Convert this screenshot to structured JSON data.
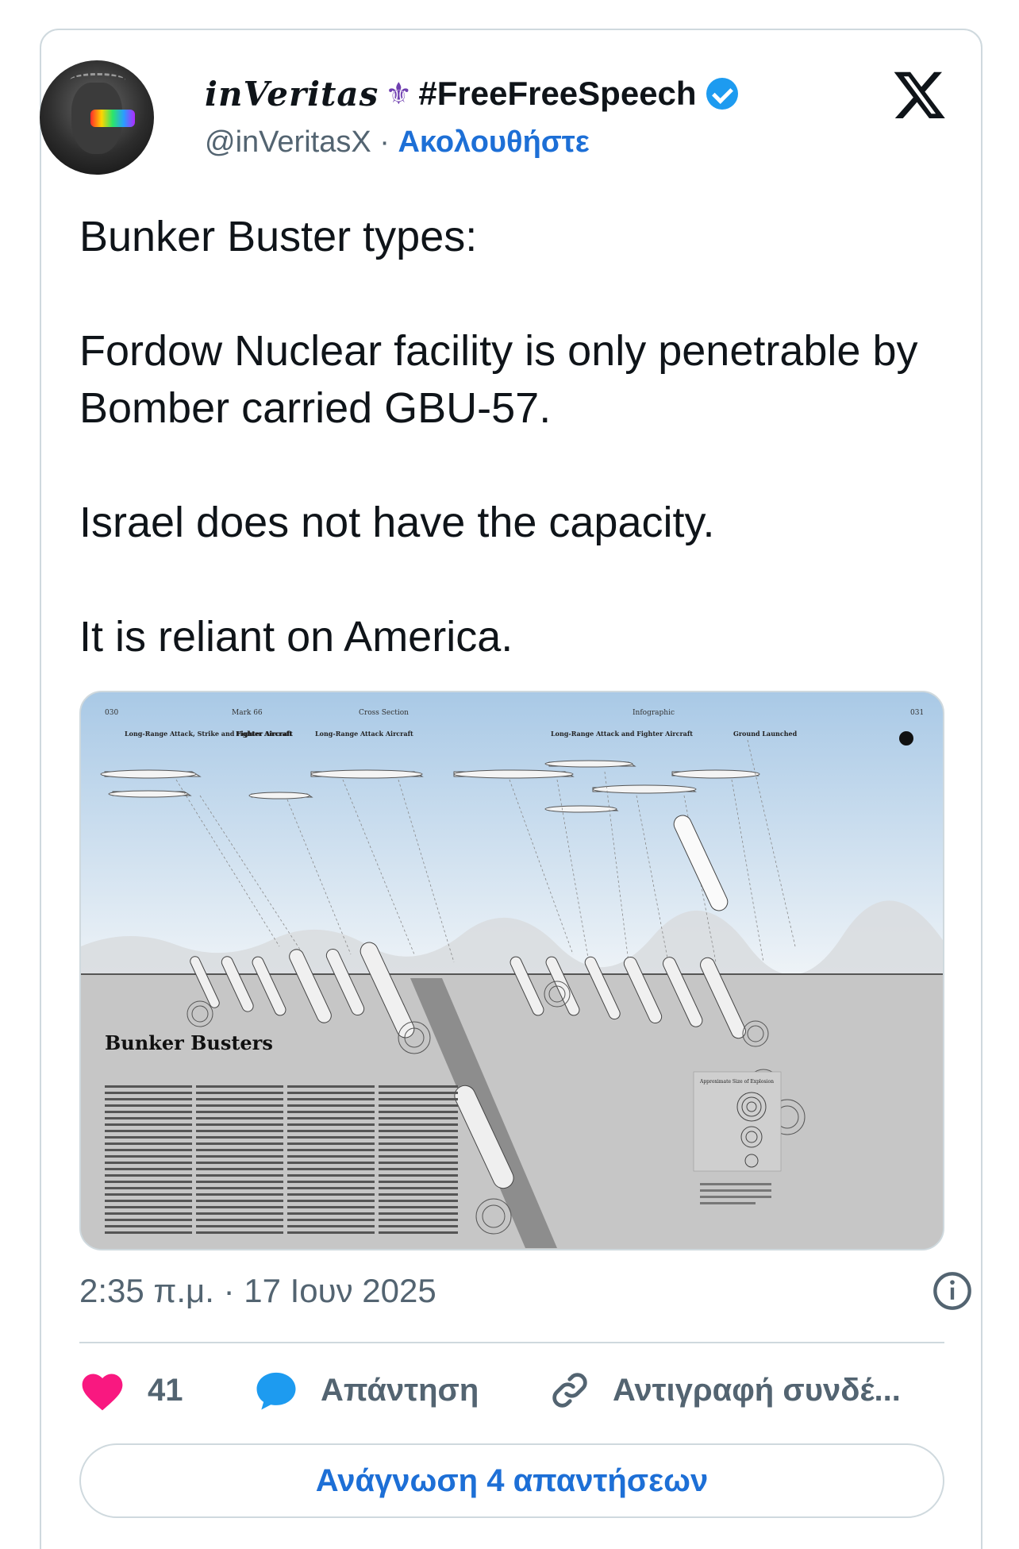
{
  "author": {
    "display_name": "inVeritas",
    "hashtag": "#FreeFreeSpeech",
    "handle": "@inVeritasX",
    "separator": "·",
    "follow_label": "Ακολουθήστε"
  },
  "tweet": {
    "lines": [
      "Bunker Buster types:",
      "Fordow Nuclear facility is only penetrable by Bomber carried GBU-57.",
      "Israel does not have the capacity.",
      "It is reliant on America."
    ]
  },
  "media": {
    "title": "Bunker Busters",
    "header_labels": [
      "030",
      "Mark 66",
      "Cross Section",
      "Infographic",
      "031"
    ],
    "category_labels": [
      "Long-Range Attack, Strike and Fighter Aircraft",
      "Fighter Aircraft",
      "Long-Range Attack Aircraft",
      "Long-Range Attack and Fighter Aircraft",
      "Ground Launched"
    ],
    "legend_title": "Approximate Size of Explosion"
  },
  "meta": {
    "timestamp": "2:35 π.μ. · 17 Ιουν 2025"
  },
  "actions": {
    "like_count": "41",
    "reply_label": "Απάντηση",
    "copy_label": "Αντιγραφή συνδέ..."
  },
  "read_replies_label": "Ανάγνωση 4 απαντήσεων",
  "colors": {
    "like": "#f91880",
    "reply": "#1d9bf0",
    "link": "#1d6fd6",
    "verified": "#1d9bf0",
    "muted": "#536471"
  }
}
